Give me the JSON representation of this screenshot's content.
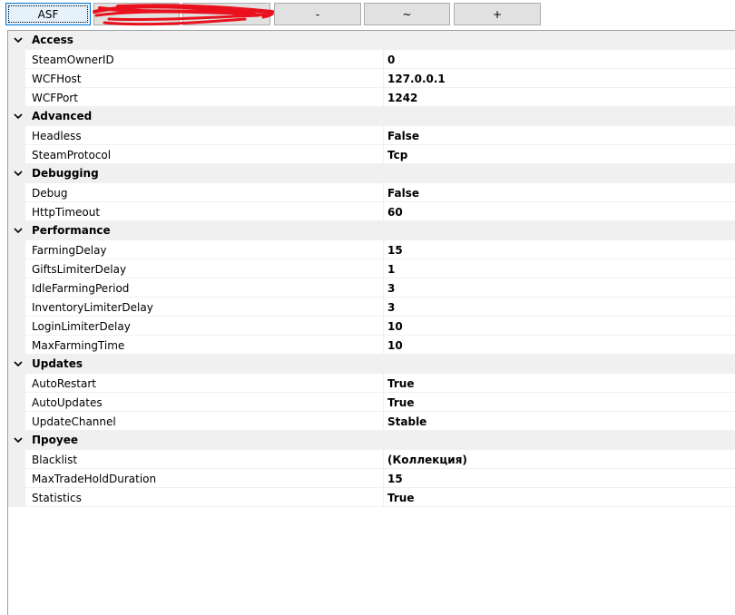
{
  "toolbar": {
    "buttons": [
      {
        "label": "ASF",
        "active": true
      },
      {
        "label": "",
        "active": false
      },
      {
        "label": "",
        "active": false
      },
      {
        "label": "-",
        "active": false
      },
      {
        "label": "~",
        "active": false
      },
      {
        "label": "+",
        "active": false
      }
    ],
    "redaction_color": "#e8111d"
  },
  "property_grid": {
    "categories": [
      {
        "name": "Access",
        "properties": [
          {
            "name": "SteamOwnerID",
            "value": "0"
          },
          {
            "name": "WCFHost",
            "value": "127.0.0.1"
          },
          {
            "name": "WCFPort",
            "value": "1242"
          }
        ]
      },
      {
        "name": "Advanced",
        "properties": [
          {
            "name": "Headless",
            "value": "False"
          },
          {
            "name": "SteamProtocol",
            "value": "Tcp"
          }
        ]
      },
      {
        "name": "Debugging",
        "properties": [
          {
            "name": "Debug",
            "value": "False"
          },
          {
            "name": "HttpTimeout",
            "value": "60"
          }
        ]
      },
      {
        "name": "Performance",
        "properties": [
          {
            "name": "FarmingDelay",
            "value": "15"
          },
          {
            "name": "GiftsLimiterDelay",
            "value": "1"
          },
          {
            "name": "IdleFarmingPeriod",
            "value": "3"
          },
          {
            "name": "InventoryLimiterDelay",
            "value": "3"
          },
          {
            "name": "LoginLimiterDelay",
            "value": "10"
          },
          {
            "name": "MaxFarmingTime",
            "value": "10"
          }
        ]
      },
      {
        "name": "Updates",
        "properties": [
          {
            "name": "AutoRestart",
            "value": "True"
          },
          {
            "name": "AutoUpdates",
            "value": "True"
          },
          {
            "name": "UpdateChannel",
            "value": "Stable"
          }
        ]
      },
      {
        "name": "Проуее",
        "properties": [
          {
            "name": "Blacklist",
            "value": "(Коллекция)"
          },
          {
            "name": "MaxTradeHoldDuration",
            "value": "15"
          },
          {
            "name": "Statistics",
            "value": "True"
          }
        ]
      }
    ]
  }
}
